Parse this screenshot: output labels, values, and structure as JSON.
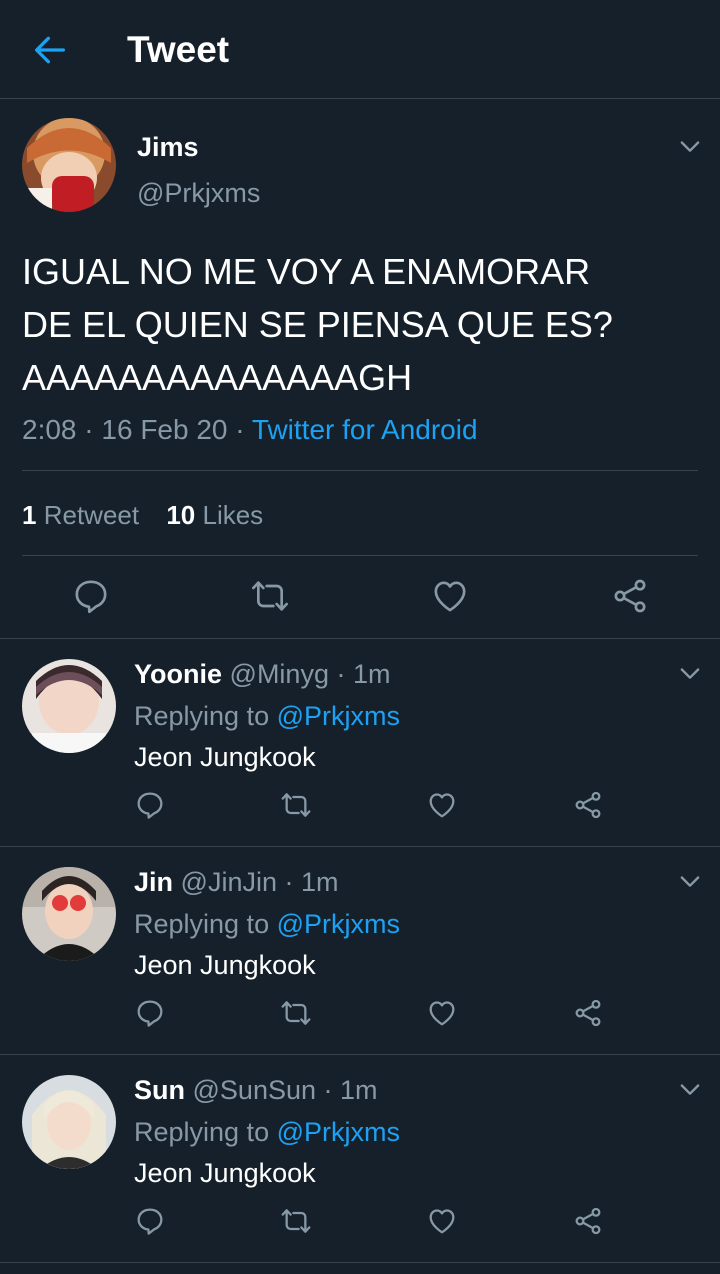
{
  "header": {
    "title": "Tweet"
  },
  "main_tweet": {
    "name": "Jims",
    "handle": "@Prkjxms",
    "text_lines": [
      "IGUAL NO ME VOY A ENAMORAR",
      "DE EL QUIEN SE PIENSA QUE ES?",
      "AAAAAAAAAAAAAAGH"
    ],
    "time": "2:08",
    "separator": " · ",
    "date": "16 Feb 20",
    "source": "Twitter for Android",
    "retweets_count": "1",
    "retweets_label": "Retweet",
    "likes_count": "10",
    "likes_label": "Likes"
  },
  "replies": [
    {
      "name": "Yoonie",
      "handle": "@Minyg",
      "time": "1m",
      "replying_label": "Replying to",
      "replying_to": "@Prkjxms",
      "text": "Jeon Jungkook"
    },
    {
      "name": "Jin",
      "handle": "@JinJin",
      "time": "1m",
      "replying_label": "Replying to",
      "replying_to": "@Prkjxms",
      "text": "Jeon Jungkook"
    },
    {
      "name": "Sun",
      "handle": "@SunSun",
      "time": "1m",
      "replying_label": "Replying to",
      "replying_to": "@Prkjxms",
      "text": "Jeon Jungkook"
    }
  ],
  "icons": {
    "back": "arrow-left-icon",
    "caret": "chevron-down-icon",
    "reply": "reply-icon",
    "retweet": "retweet-icon",
    "like": "heart-icon",
    "share": "share-icon"
  },
  "colors": {
    "background": "#15202b",
    "accent": "#1da1f2",
    "secondary_text": "#8899a6",
    "divider": "#38444d"
  }
}
